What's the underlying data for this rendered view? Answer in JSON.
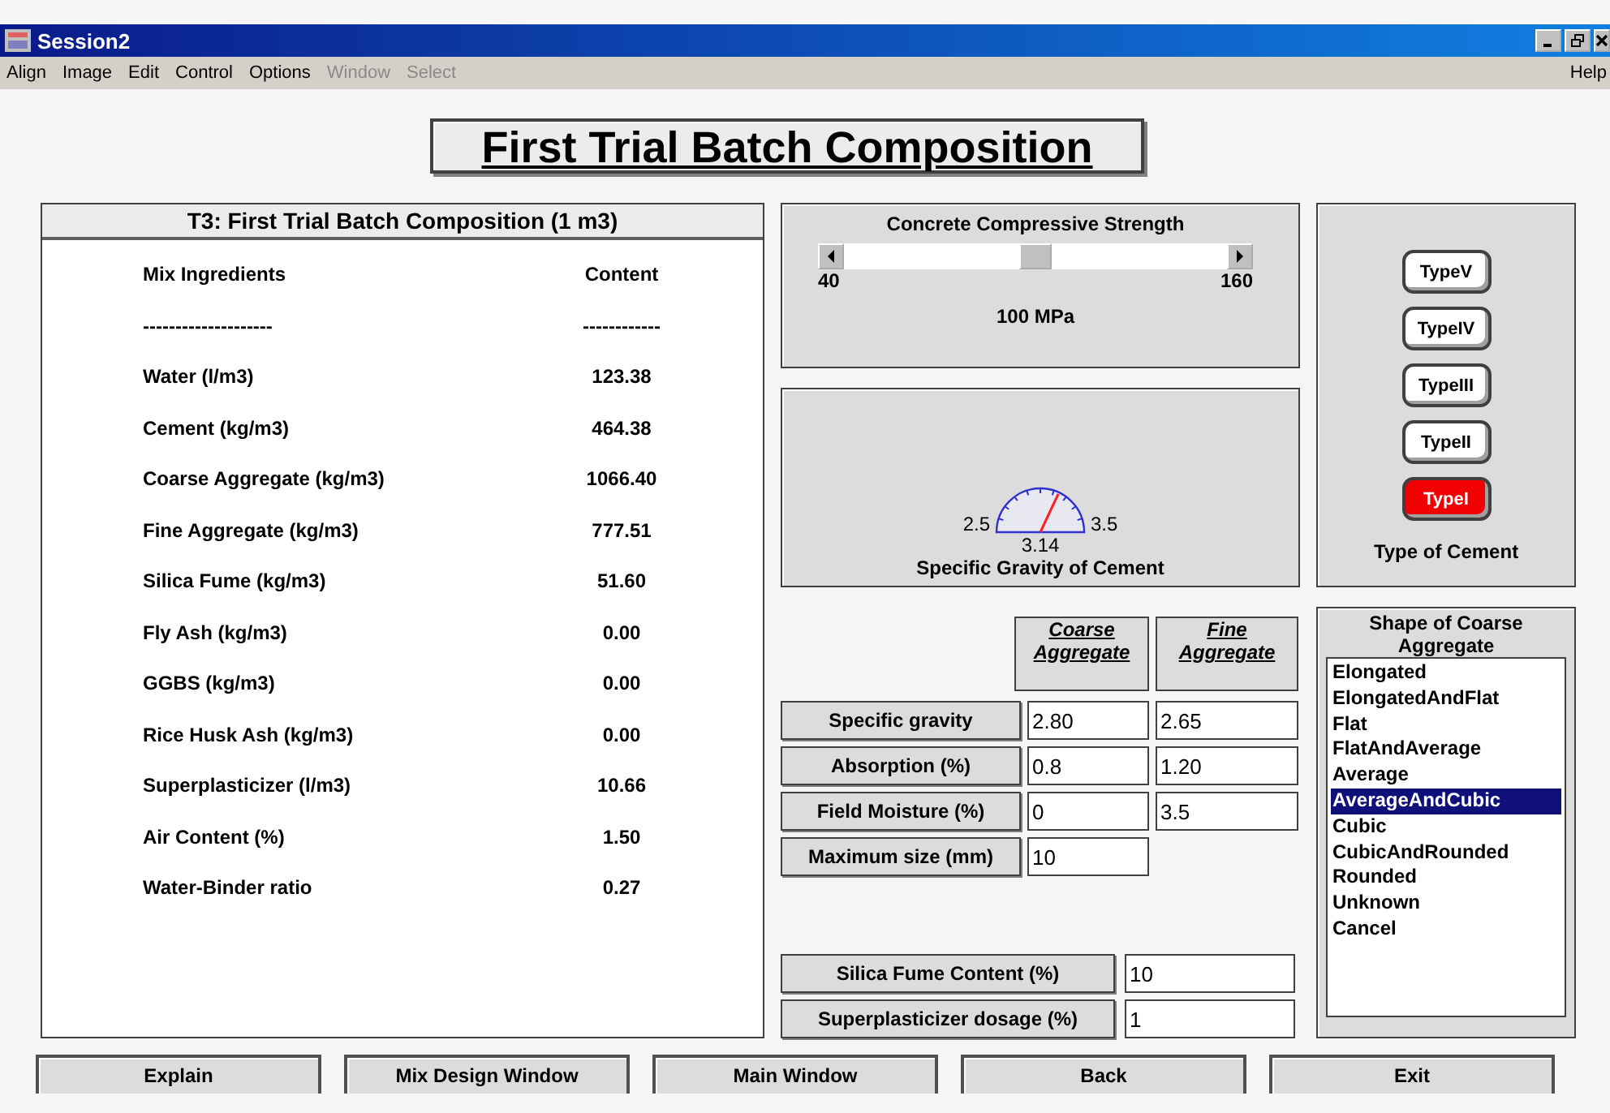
{
  "window": {
    "title": "Session2"
  },
  "menu": [
    {
      "label": "Align",
      "disabled": false
    },
    {
      "label": "Image",
      "disabled": false
    },
    {
      "label": "Edit",
      "disabled": false
    },
    {
      "label": "Control",
      "disabled": false
    },
    {
      "label": "Options",
      "disabled": false
    },
    {
      "label": "Window",
      "disabled": true
    },
    {
      "label": "Select",
      "disabled": true
    }
  ],
  "help_menu": "Help",
  "heading": "First Trial Batch Composition",
  "composition": {
    "title": "T3: First Trial Batch Composition (1 m3)",
    "columns": [
      "Mix Ingredients",
      "Content"
    ],
    "separators": [
      "--------------------",
      "------------"
    ],
    "rows": [
      {
        "name": "Water (l/m3)",
        "value": "123.38"
      },
      {
        "name": "Cement (kg/m3)",
        "value": "464.38"
      },
      {
        "name": "Coarse Aggregate (kg/m3)",
        "value": "1066.40"
      },
      {
        "name": "Fine Aggregate (kg/m3)",
        "value": "777.51"
      },
      {
        "name": "Silica Fume (kg/m3)",
        "value": "51.60"
      },
      {
        "name": "Fly Ash (kg/m3)",
        "value": "0.00"
      },
      {
        "name": "GGBS (kg/m3)",
        "value": "0.00"
      },
      {
        "name": "Rice Husk Ash (kg/m3)",
        "value": "0.00"
      },
      {
        "name": "Superplasticizer (l/m3)",
        "value": "10.66"
      },
      {
        "name": "Air Content (%)",
        "value": "1.50"
      },
      {
        "name": "Water-Binder ratio",
        "value": "0.27"
      }
    ]
  },
  "strength": {
    "title": "Concrete Compressive Strength",
    "level": 0.5,
    "min": "40",
    "max": "160",
    "reading": "100 MPa"
  },
  "gravity": {
    "min": "2.5",
    "max": "3.5",
    "reading": "3.14",
    "caption": "Specific Gravity of Cement"
  },
  "cement_types": {
    "options": [
      {
        "label": "TypeV",
        "selected": false
      },
      {
        "label": "TypeIV",
        "selected": false
      },
      {
        "label": "TypeIII",
        "selected": false
      },
      {
        "label": "TypeII",
        "selected": false
      },
      {
        "label": "TypeI",
        "selected": true
      }
    ],
    "caption": "Type of Cement"
  },
  "aggregates": {
    "columns": [
      "Coarse Aggregate",
      "Fine Aggregate"
    ],
    "rows": [
      {
        "label": "Specific gravity",
        "coarse": "2.80",
        "fine": "2.65"
      },
      {
        "label": "Absorption (%)",
        "coarse": "0.8",
        "fine": "1.20"
      },
      {
        "label": "Field Moisture (%)",
        "coarse": "0",
        "fine": "3.5"
      },
      {
        "label": "Maximum size (mm)",
        "coarse": "10"
      }
    ]
  },
  "admixtures": [
    {
      "label": "Silica Fume Content (%)",
      "value": "10"
    },
    {
      "label": "Superplasticizer dosage (%)",
      "value": "1"
    }
  ],
  "shape": {
    "title": "Shape of Coarse Aggregate",
    "options": [
      {
        "label": "Elongated",
        "selected": false
      },
      {
        "label": "ElongatedAndFlat",
        "selected": false
      },
      {
        "label": "Flat",
        "selected": false
      },
      {
        "label": "FlatAndAverage",
        "selected": false
      },
      {
        "label": "Average",
        "selected": false
      },
      {
        "label": "AverageAndCubic",
        "selected": true
      },
      {
        "label": "Cubic",
        "selected": false
      },
      {
        "label": "CubicAndRounded",
        "selected": false
      },
      {
        "label": "Rounded",
        "selected": false
      },
      {
        "label": "Unknown",
        "selected": false
      },
      {
        "label": "Cancel",
        "selected": false
      }
    ]
  },
  "buttons": [
    "Explain",
    "Mix Design Window",
    "Main Window",
    "Back",
    "Exit"
  ]
}
